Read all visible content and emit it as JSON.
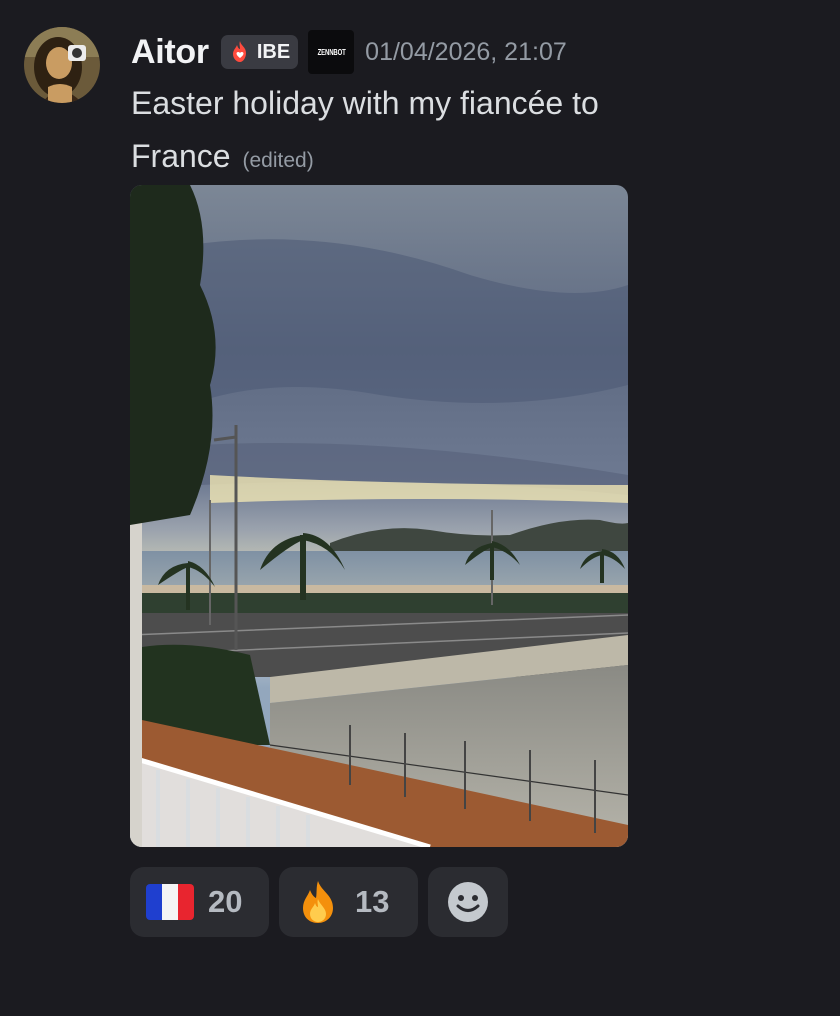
{
  "message": {
    "author": {
      "name": "Aitor",
      "avatar_icon": "portrait-avatar"
    },
    "guild_tag": {
      "icon": "fire-heart-icon",
      "label": "IBE"
    },
    "bot_badge": {
      "label": "ZENNBOT"
    },
    "timestamp": "01/04/2026, 21:07",
    "text": "Easter holiday with my fiancée to France",
    "edited_label": "(edited)",
    "attachment": {
      "kind": "photo",
      "subject": "seaside-promenade-sunset-photo"
    },
    "reactions": [
      {
        "emoji": "flag-france",
        "count": "20"
      },
      {
        "emoji": "fire",
        "count": "13"
      }
    ],
    "add_reaction_icon": "smiley-icon"
  },
  "colors": {
    "background": "#1b1b20",
    "username": "#f2f3f5",
    "message_text": "#dbdee1",
    "muted_text": "#949ba4",
    "reaction_bg": "#2b2c31",
    "guild_tag_bg": "#3a3b42"
  }
}
